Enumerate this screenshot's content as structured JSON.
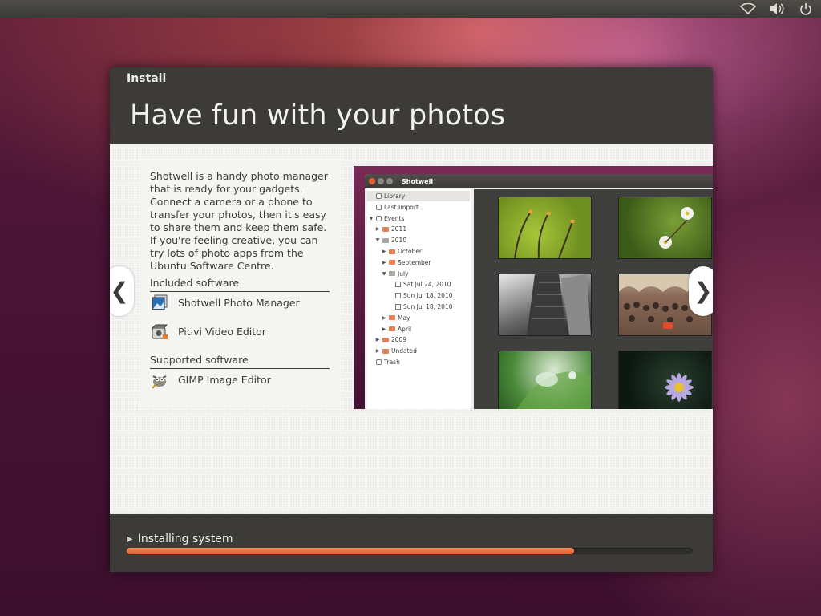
{
  "top_panel": {
    "icons": [
      "wifi-icon",
      "volume-icon",
      "power-icon"
    ]
  },
  "window": {
    "title": "Install"
  },
  "slide": {
    "heading": "Have fun with your photos",
    "description": "Shotwell is a handy photo manager that is ready for your gadgets. Connect a camera or a phone to transfer your photos, then it's easy to share them and keep them safe. If you're feeling creative, you can try lots of photo apps from the Ubuntu Software Centre.",
    "included_title": "Included software",
    "included": [
      {
        "label": "Shotwell Photo Manager",
        "icon": "shotwell-icon"
      },
      {
        "label": "Pitivi Video Editor",
        "icon": "pitivi-icon"
      }
    ],
    "supported_title": "Supported software",
    "supported": [
      {
        "label": "GIMP Image Editor",
        "icon": "gimp-icon"
      }
    ],
    "prev_arrow": "❮",
    "next_arrow": "❯"
  },
  "shotwell": {
    "title": "Shotwell",
    "tree": [
      {
        "label": "Library",
        "depth": 0,
        "icon": "library",
        "selected": true
      },
      {
        "label": "Last Import",
        "depth": 0,
        "icon": "import"
      },
      {
        "label": "Events",
        "depth": 0,
        "icon": "events",
        "expander": "▼"
      },
      {
        "label": "2011",
        "depth": 1,
        "icon": "folder",
        "expander": "▶"
      },
      {
        "label": "2010",
        "depth": 1,
        "icon": "folder-grey",
        "expander": "▼"
      },
      {
        "label": "October",
        "depth": 2,
        "icon": "folder",
        "expander": "▶"
      },
      {
        "label": "September",
        "depth": 2,
        "icon": "folder",
        "expander": "▶"
      },
      {
        "label": "July",
        "depth": 2,
        "icon": "folder-grey",
        "expander": "▼"
      },
      {
        "label": "Sat Jul 24, 2010",
        "depth": 3,
        "icon": "cal"
      },
      {
        "label": "Sun Jul 18, 2010",
        "depth": 3,
        "icon": "cal"
      },
      {
        "label": "Sun Jul 18, 2010",
        "depth": 3,
        "icon": "cal"
      },
      {
        "label": "May",
        "depth": 2,
        "icon": "folder",
        "expander": "▶"
      },
      {
        "label": "April",
        "depth": 2,
        "icon": "folder",
        "expander": "▶"
      },
      {
        "label": "2009",
        "depth": 1,
        "icon": "folder",
        "expander": "▶"
      },
      {
        "label": "Undated",
        "depth": 1,
        "icon": "folder",
        "expander": "▶"
      },
      {
        "label": "Trash",
        "depth": 0,
        "icon": "trash"
      }
    ],
    "thumbnails": [
      {
        "name": "green-stems-photo"
      },
      {
        "name": "white-blossom-photo"
      },
      {
        "name": "skyscraper-bw-photo"
      },
      {
        "name": "group-crowd-photo"
      },
      {
        "name": "waterdrop-leaf-photo"
      },
      {
        "name": "purple-aster-photo"
      }
    ]
  },
  "progress": {
    "label": "Installing system",
    "fraction": 0.79,
    "expander": "▶"
  },
  "colors": {
    "accent": "#e0582a",
    "window_bg": "#3c3b37",
    "slide_bg": "#f4f4f2"
  }
}
